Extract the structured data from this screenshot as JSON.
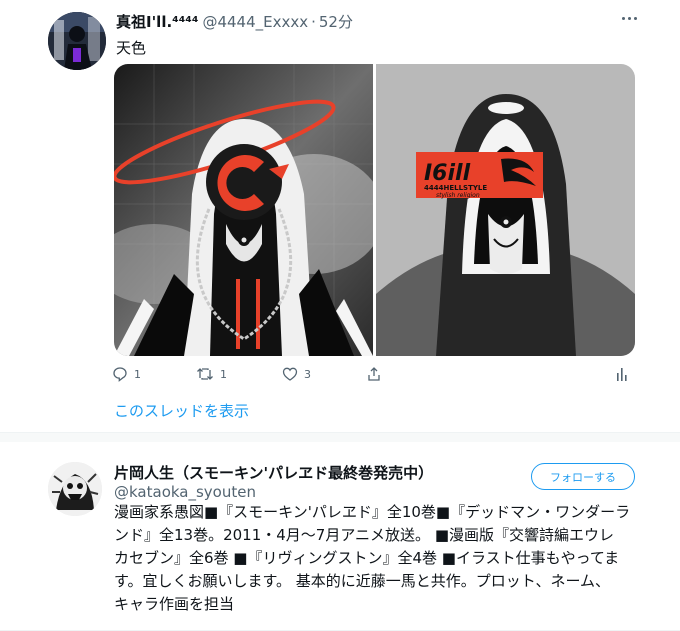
{
  "tweet": {
    "author_name": "真祖I'll.⁴⁴⁴⁴",
    "author_handle": "@4444_Exxxx",
    "separator": "·",
    "time": "52分",
    "text": "天色",
    "right_image_logo_text": "I6ill",
    "right_image_sub_text": "4444HELLSTYLE",
    "right_image_tagline": "stylish religion",
    "actions": {
      "reply_count": "1",
      "retweet_count": "1",
      "like_count": "3"
    },
    "show_thread": "このスレッドを表示"
  },
  "profile": {
    "name": "片岡人生（スモーキン'パレヱド最終巻発売中）",
    "handle": "@kataoka_syouten",
    "follow_label": "フォローする",
    "bio_lines": [
      "漫画家系愚図■『スモーキン'パレヱド』全10巻■『デッドマン・ワンダーラ",
      "ンド』全13巻。2011・4月〜7月アニメ放送。 ■漫画版『交響詩編エウレ",
      "カセブン』全6巻 ■『リヴィングストン』全4巻 ■イラスト仕事もやってま",
      "す。宜しくお願いします。 基本的に近藤一馬と共作。プロット、ネーム、",
      "キャラ作画を担当"
    ]
  },
  "colors": {
    "accent": "#1d9bf0",
    "secondary_text": "#536471",
    "primary_text": "#0f1419",
    "art_red": "#e8412a"
  },
  "icons": {
    "more": "more-dots-icon",
    "reply": "reply-icon",
    "retweet": "retweet-icon",
    "like": "heart-icon",
    "share": "share-icon",
    "analytics": "analytics-icon"
  }
}
